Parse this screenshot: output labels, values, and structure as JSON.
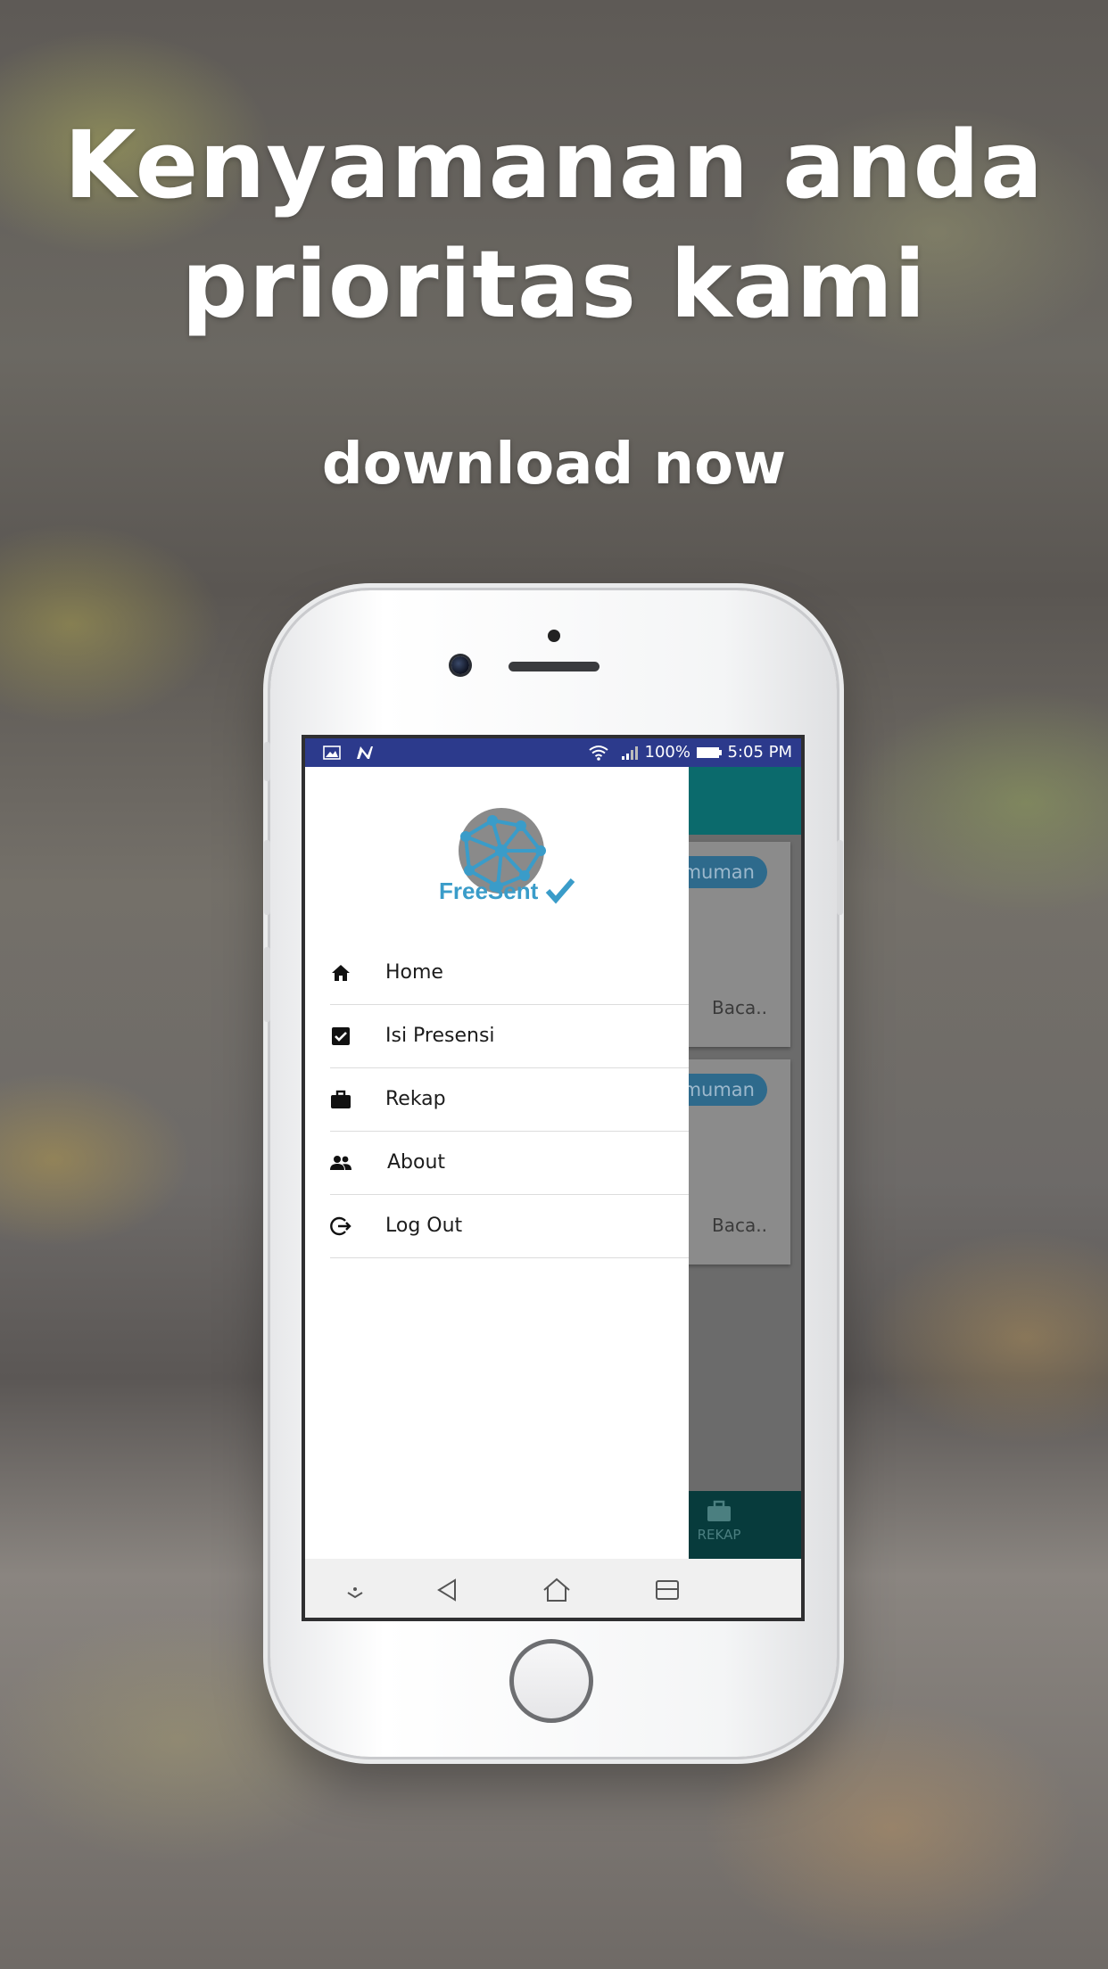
{
  "promo": {
    "headline_line1": "Kenyamanan anda",
    "headline_line2": "prioritas kami",
    "subline": "download now"
  },
  "status_bar": {
    "battery": "100%",
    "time": "5:05 PM"
  },
  "drawer": {
    "brand": "FreeSent",
    "menu": [
      {
        "label": "Home",
        "icon": "home-icon"
      },
      {
        "label": "Isi Presensi",
        "icon": "checkbox-icon"
      },
      {
        "label": "Rekap",
        "icon": "briefcase-icon"
      },
      {
        "label": "About",
        "icon": "people-icon"
      },
      {
        "label": "Log Out",
        "icon": "logout-icon"
      }
    ]
  },
  "background_app": {
    "cards": [
      {
        "chip": "...muman",
        "action": "Baca.."
      },
      {
        "chip": "...muman",
        "action": "Baca.."
      }
    ],
    "bottom_tab": "REKAP"
  },
  "colors": {
    "status_bar": "#2c3a8c",
    "toolbar": "#0b6a6c",
    "accent": "#3a9cc9"
  }
}
